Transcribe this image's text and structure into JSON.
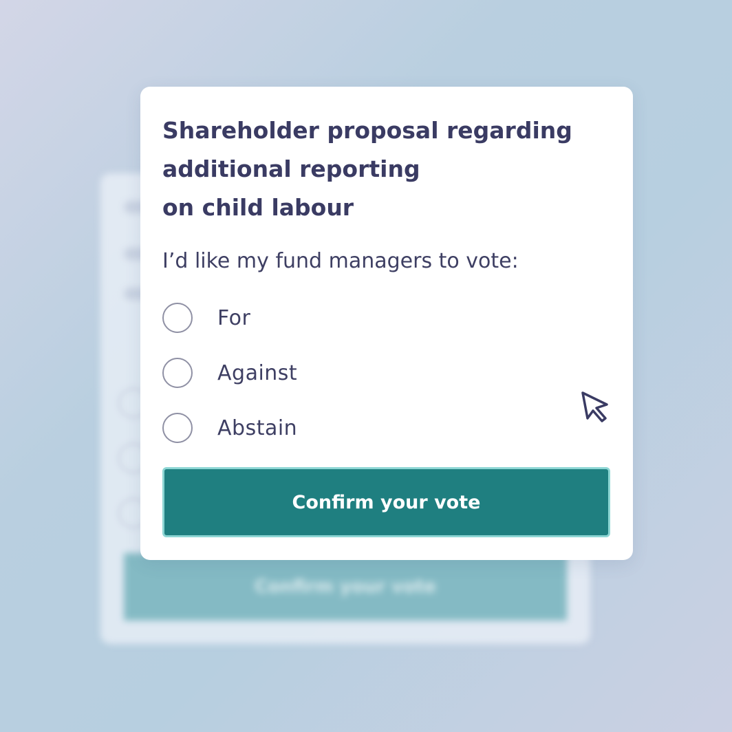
{
  "card": {
    "title_lines": [
      "Shareholder proposal regarding",
      "additional reporting",
      "on child labour"
    ],
    "prompt": "I’d like my fund managers to vote:",
    "options": [
      {
        "label": "For",
        "selected": false
      },
      {
        "label": "Against",
        "selected": false
      },
      {
        "label": "Abstain",
        "selected": false
      }
    ],
    "confirm_label": "Confirm your vote"
  },
  "background_card": {
    "confirm_label": "Confirm your vote"
  },
  "icons": {
    "cursor": "mouse-pointer-icon"
  },
  "colors": {
    "primary": "#1f7f80",
    "primary_border": "#8dd6d4",
    "text": "#3a3b63",
    "radio_border": "#8f90a4"
  }
}
